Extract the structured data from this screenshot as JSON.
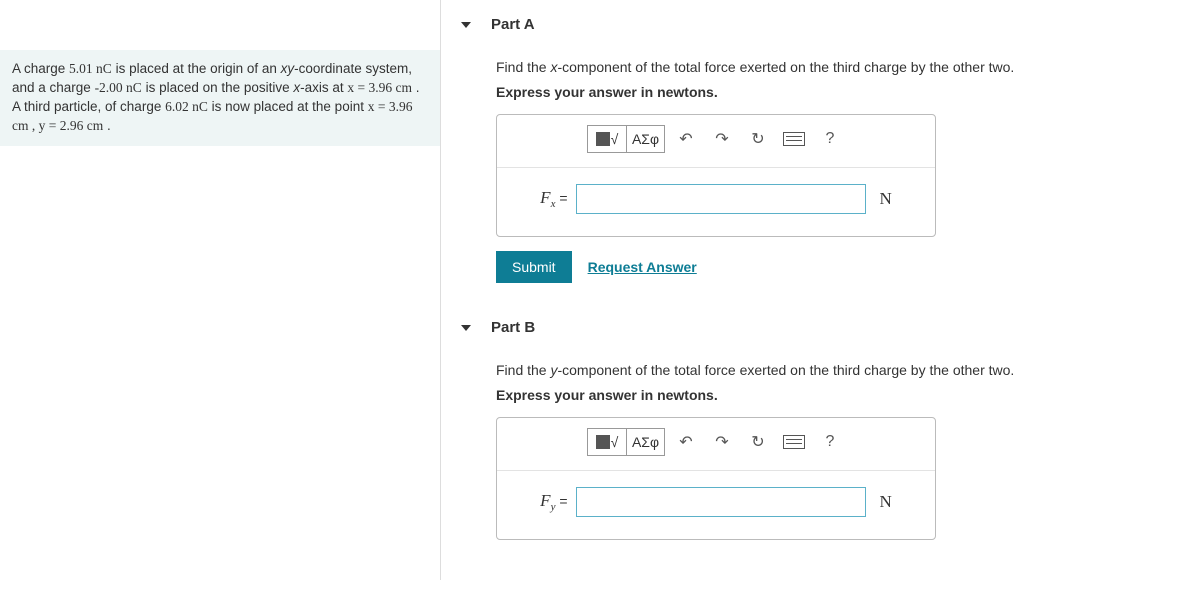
{
  "problem": {
    "text_prefix": "A charge ",
    "q1": "5.01 nC",
    "text_mid1": " is placed at the origin of an ",
    "frame": "xy",
    "text_mid2": "-coordinate system, and a charge ",
    "q2": "-2.00 nC",
    "text_mid3": " is placed on the positive ",
    "axis": "x",
    "text_mid4": "-axis at ",
    "x1": "x = 3.96 cm",
    "text_mid5": " . A third particle, of charge ",
    "q3": "6.02 nC",
    "text_mid6": " is now placed at the point ",
    "pos": "x = 3.96 cm , y = 2.96 cm",
    "text_end": " ."
  },
  "parts": {
    "a": {
      "title": "Part A",
      "prompt_prefix": "Find the ",
      "component": "x",
      "prompt_suffix": "-component of the total force exerted on the third charge by the other two.",
      "hint": "Express your answer in newtons.",
      "var_letter": "F",
      "var_sub": "x",
      "equals": " = ",
      "unit": "N",
      "symbols_label": "ΑΣφ"
    },
    "b": {
      "title": "Part B",
      "prompt_prefix": "Find the ",
      "component": "y",
      "prompt_suffix": "-component of the total force exerted on the third charge by the other two.",
      "hint": "Express your answer in newtons.",
      "var_letter": "F",
      "var_sub": "y",
      "equals": " = ",
      "unit": "N",
      "symbols_label": "ΑΣφ"
    }
  },
  "actions": {
    "submit": "Submit",
    "request": "Request Answer"
  },
  "toolbar": {
    "help": "?"
  }
}
